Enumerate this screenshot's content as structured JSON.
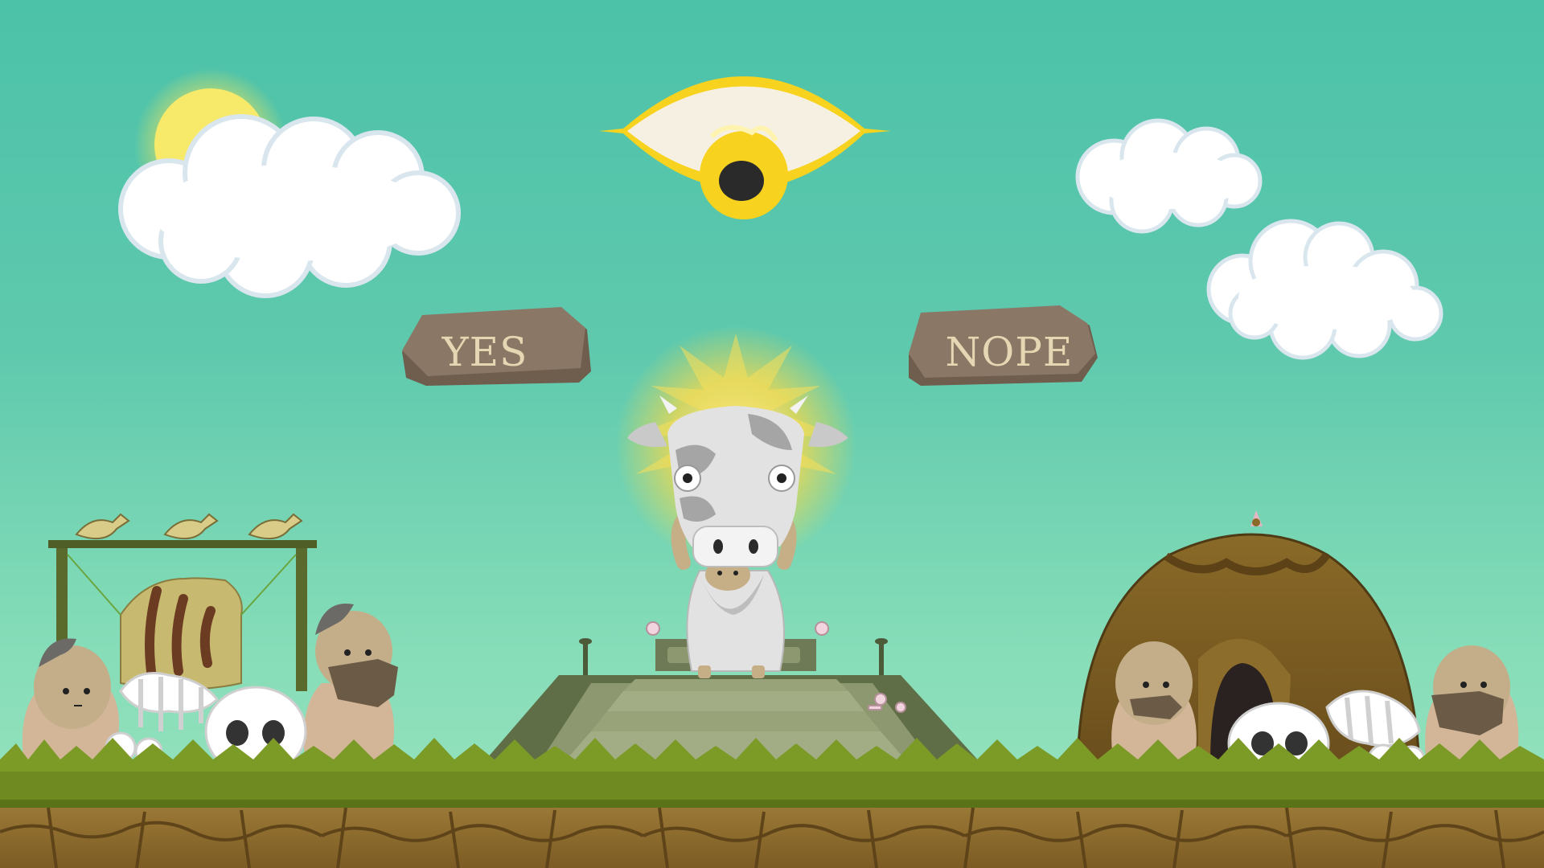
{
  "choices": {
    "yes_label": "YES",
    "no_label": "NOPE"
  },
  "colors": {
    "sky_top": "#4cc2a9",
    "sky_bottom": "#9ae3bf",
    "stone": "#8b7766",
    "stone_text": "#e6d7b4",
    "grass": "#6e8a20",
    "soil": "#8a6a2c",
    "eye_gold": "#f7d21e"
  },
  "icons": [
    "sun-icon",
    "cloud-icon",
    "all-seeing-eye-icon",
    "cow-god-icon",
    "hut-icon",
    "bird-icon",
    "skull-icon",
    "caveman-icon"
  ]
}
